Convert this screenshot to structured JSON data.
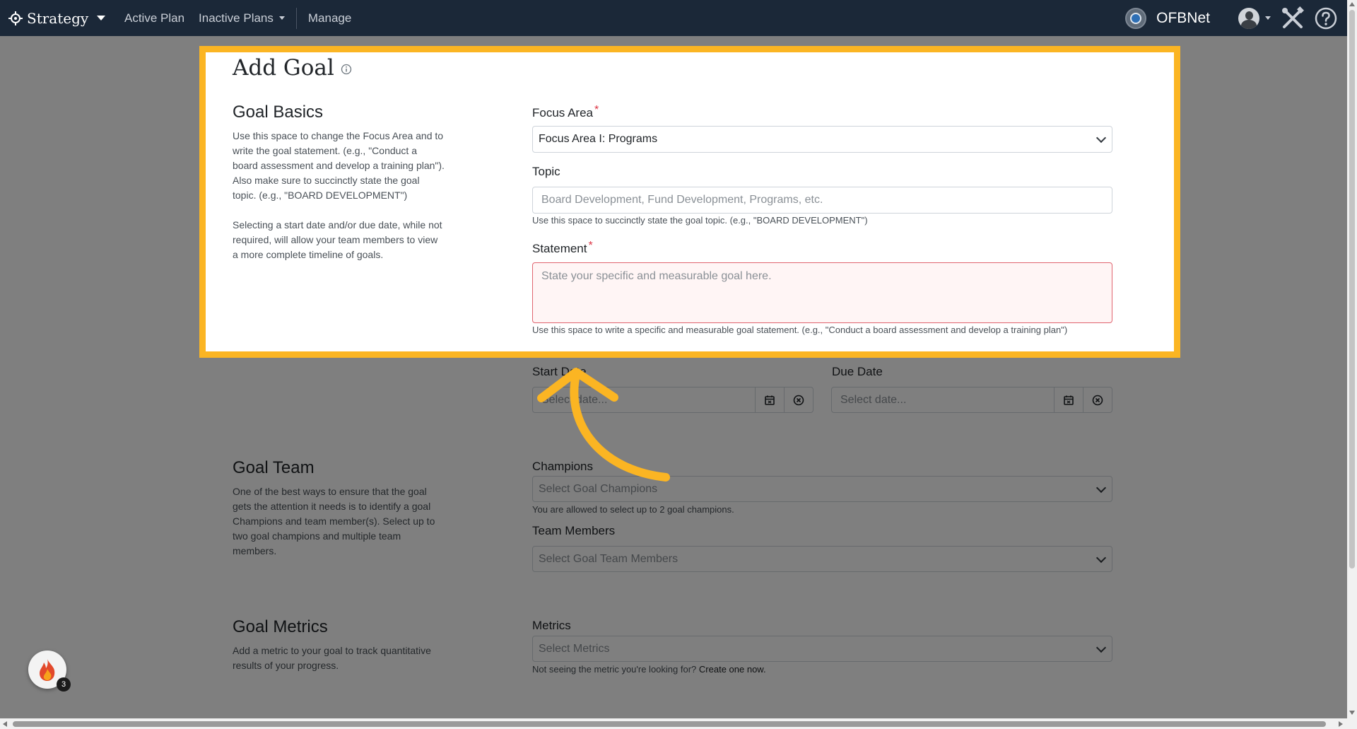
{
  "nav": {
    "brand": "Strategy",
    "links": [
      "Active Plan",
      "Inactive Plans",
      "Manage"
    ],
    "org_name": "OFBNet"
  },
  "page": {
    "title": "Add Goal",
    "basics": {
      "title": "Goal Basics",
      "desc1": "Use this space to change the Focus Area and to write the goal statement. (e.g., \"Conduct a board assessment and develop a training plan\"). Also make sure to succinctly state the goal topic. (e.g., \"BOARD DEVELOPMENT\")",
      "desc2": "Selecting a start date and/or due date, while not required, will allow your team members to view a more complete timeline of goals."
    },
    "focus_area": {
      "label": "Focus Area",
      "value": "Focus Area I: Programs"
    },
    "topic": {
      "label": "Topic",
      "placeholder": "Board Development, Fund Development, Programs, etc.",
      "help": "Use this space to succinctly state the goal topic. (e.g., \"BOARD DEVELOPMENT\")"
    },
    "statement": {
      "label": "Statement",
      "placeholder": "State your specific and measurable goal here.",
      "help": "Use this space to write a specific and measurable goal statement. (e.g., \"Conduct a board assessment and develop a training plan\")"
    },
    "start_date": {
      "label": "Start Date",
      "placeholder": "Select date..."
    },
    "due_date": {
      "label": "Due Date",
      "placeholder": "Select date..."
    },
    "team": {
      "title": "Goal Team",
      "desc": "One of the best ways to ensure that the goal gets the attention it needs is to identify a goal Champions and team member(s). Select up to two goal champions and multiple team members.",
      "champions_label": "Champions",
      "champions_placeholder": "Select Goal Champions",
      "champions_help": "You are allowed to select up to 2 goal champions.",
      "members_label": "Team Members",
      "members_placeholder": "Select Goal Team Members"
    },
    "metrics": {
      "title": "Goal Metrics",
      "desc": "Add a metric to your goal to track quantitative results of your progress.",
      "label": "Metrics",
      "placeholder": "Select Metrics",
      "help": "Not seeing the metric you're looking for?",
      "help_link": "Create one now."
    }
  },
  "notifications": {
    "count": "3"
  },
  "colors": {
    "nav_bg": "#1b2838",
    "highlight": "#fbb523",
    "required": "#dc3545"
  },
  "icons": [
    "target-icon",
    "info-icon",
    "chevron-down-icon",
    "calendar-icon",
    "clear-icon",
    "tools-icon",
    "help-icon",
    "fire-icon",
    "arrow-pointer"
  ]
}
